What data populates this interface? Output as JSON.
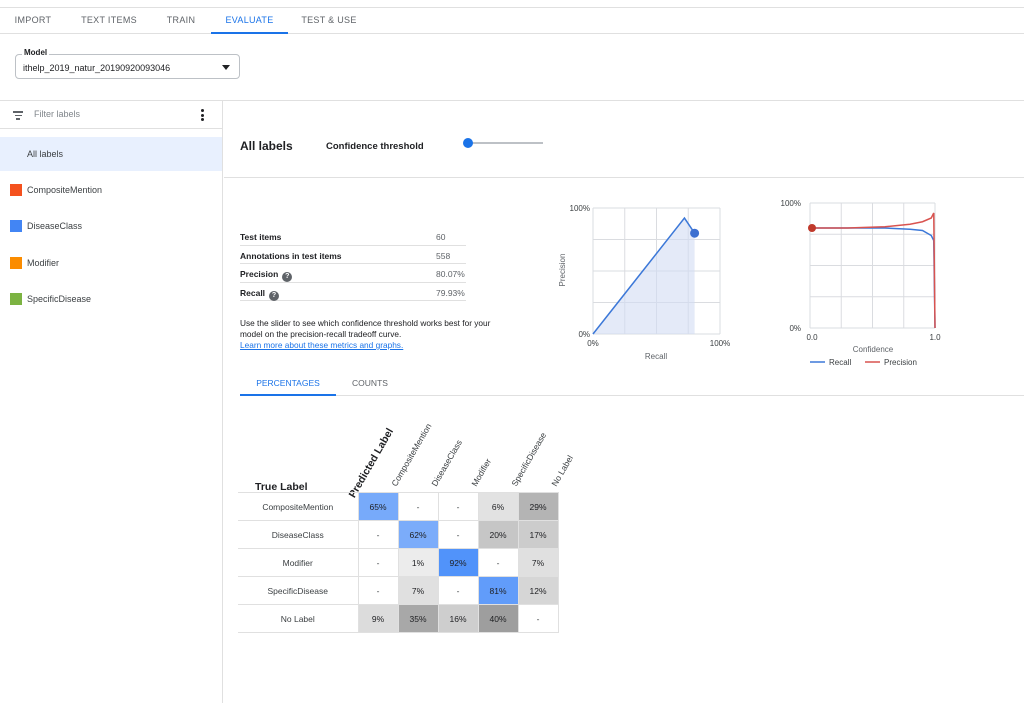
{
  "tabs": [
    "IMPORT",
    "TEXT ITEMS",
    "TRAIN",
    "EVALUATE",
    "TEST & USE"
  ],
  "active_tab": "EVALUATE",
  "model": {
    "label": "Model",
    "value": "ithelp_2019_natur_20190920093046"
  },
  "sidebar": {
    "filter_placeholder": "Filter labels",
    "items": [
      {
        "label": "All labels",
        "color": ""
      },
      {
        "label": "CompositeMention",
        "color": "#f4511e"
      },
      {
        "label": "DiseaseClass",
        "color": "#4285f4"
      },
      {
        "label": "Modifier",
        "color": "#fb8c00"
      },
      {
        "label": "SpecificDisease",
        "color": "#7cb342"
      }
    ]
  },
  "header": {
    "title": "All labels",
    "confidence_label": "Confidence threshold",
    "confidence_value": 0
  },
  "metrics": [
    {
      "label": "Test items",
      "value": "60"
    },
    {
      "label": "Annotations in test items",
      "value": "558"
    },
    {
      "label": "Precision",
      "value": "80.07%"
    },
    {
      "label": "Recall",
      "value": "79.93%"
    }
  ],
  "info_text": "Use the slider to see which confidence threshold works best for your model on the precision-recall tradeoff curve.",
  "info_link": "Learn more about these metrics and graphs.",
  "pr_chart": {
    "y_top": "100%",
    "y_bottom": "0%",
    "x_left": "0%",
    "x_right": "100%",
    "ylabel": "Precision",
    "xlabel": "Recall"
  },
  "conf_chart": {
    "y_top": "100%",
    "y_bottom": "0%",
    "x_left": "0.0",
    "x_right": "1.0",
    "xlabel": "Confidence",
    "legend": [
      "Recall",
      "Precision"
    ]
  },
  "chart_data": [
    {
      "type": "area",
      "x": [
        0.0,
        0.72,
        0.8
      ],
      "y": [
        0.0,
        0.92,
        0.8
      ],
      "xlabel": "Recall",
      "ylabel": "Precision",
      "xlim": [
        0,
        1
      ],
      "ylim": [
        0,
        1
      ]
    },
    {
      "type": "line",
      "x": [
        0.0,
        0.3,
        0.6,
        0.8,
        0.9,
        0.97,
        0.99,
        1.0
      ],
      "series": [
        {
          "name": "Recall",
          "values": [
            0.8,
            0.8,
            0.8,
            0.79,
            0.78,
            0.74,
            0.7,
            0.0
          ]
        },
        {
          "name": "Precision",
          "values": [
            0.8,
            0.8,
            0.81,
            0.83,
            0.85,
            0.88,
            0.92,
            0.0
          ]
        }
      ],
      "xlabel": "Confidence",
      "xlim": [
        0,
        1
      ],
      "ylim": [
        0,
        1
      ]
    }
  ],
  "subtabs": [
    "PERCENTAGES",
    "COUNTS"
  ],
  "matrix": {
    "true_label": "True Label",
    "predicted_label": "Predicted Label",
    "columns": [
      "CompositeMention",
      "DiseaseClass",
      "Modifier",
      "SpecificDisease",
      "No Label"
    ],
    "rows": [
      {
        "label": "CompositeMention",
        "cells": [
          "65%",
          "-",
          "-",
          "6%",
          "29%"
        ]
      },
      {
        "label": "DiseaseClass",
        "cells": [
          "-",
          "62%",
          "-",
          "20%",
          "17%"
        ]
      },
      {
        "label": "Modifier",
        "cells": [
          "-",
          "1%",
          "92%",
          "-",
          "7%"
        ]
      },
      {
        "label": "SpecificDisease",
        "cells": [
          "-",
          "7%",
          "-",
          "81%",
          "12%"
        ]
      },
      {
        "label": "No Label",
        "cells": [
          "9%",
          "35%",
          "16%",
          "40%",
          "-"
        ]
      }
    ]
  }
}
